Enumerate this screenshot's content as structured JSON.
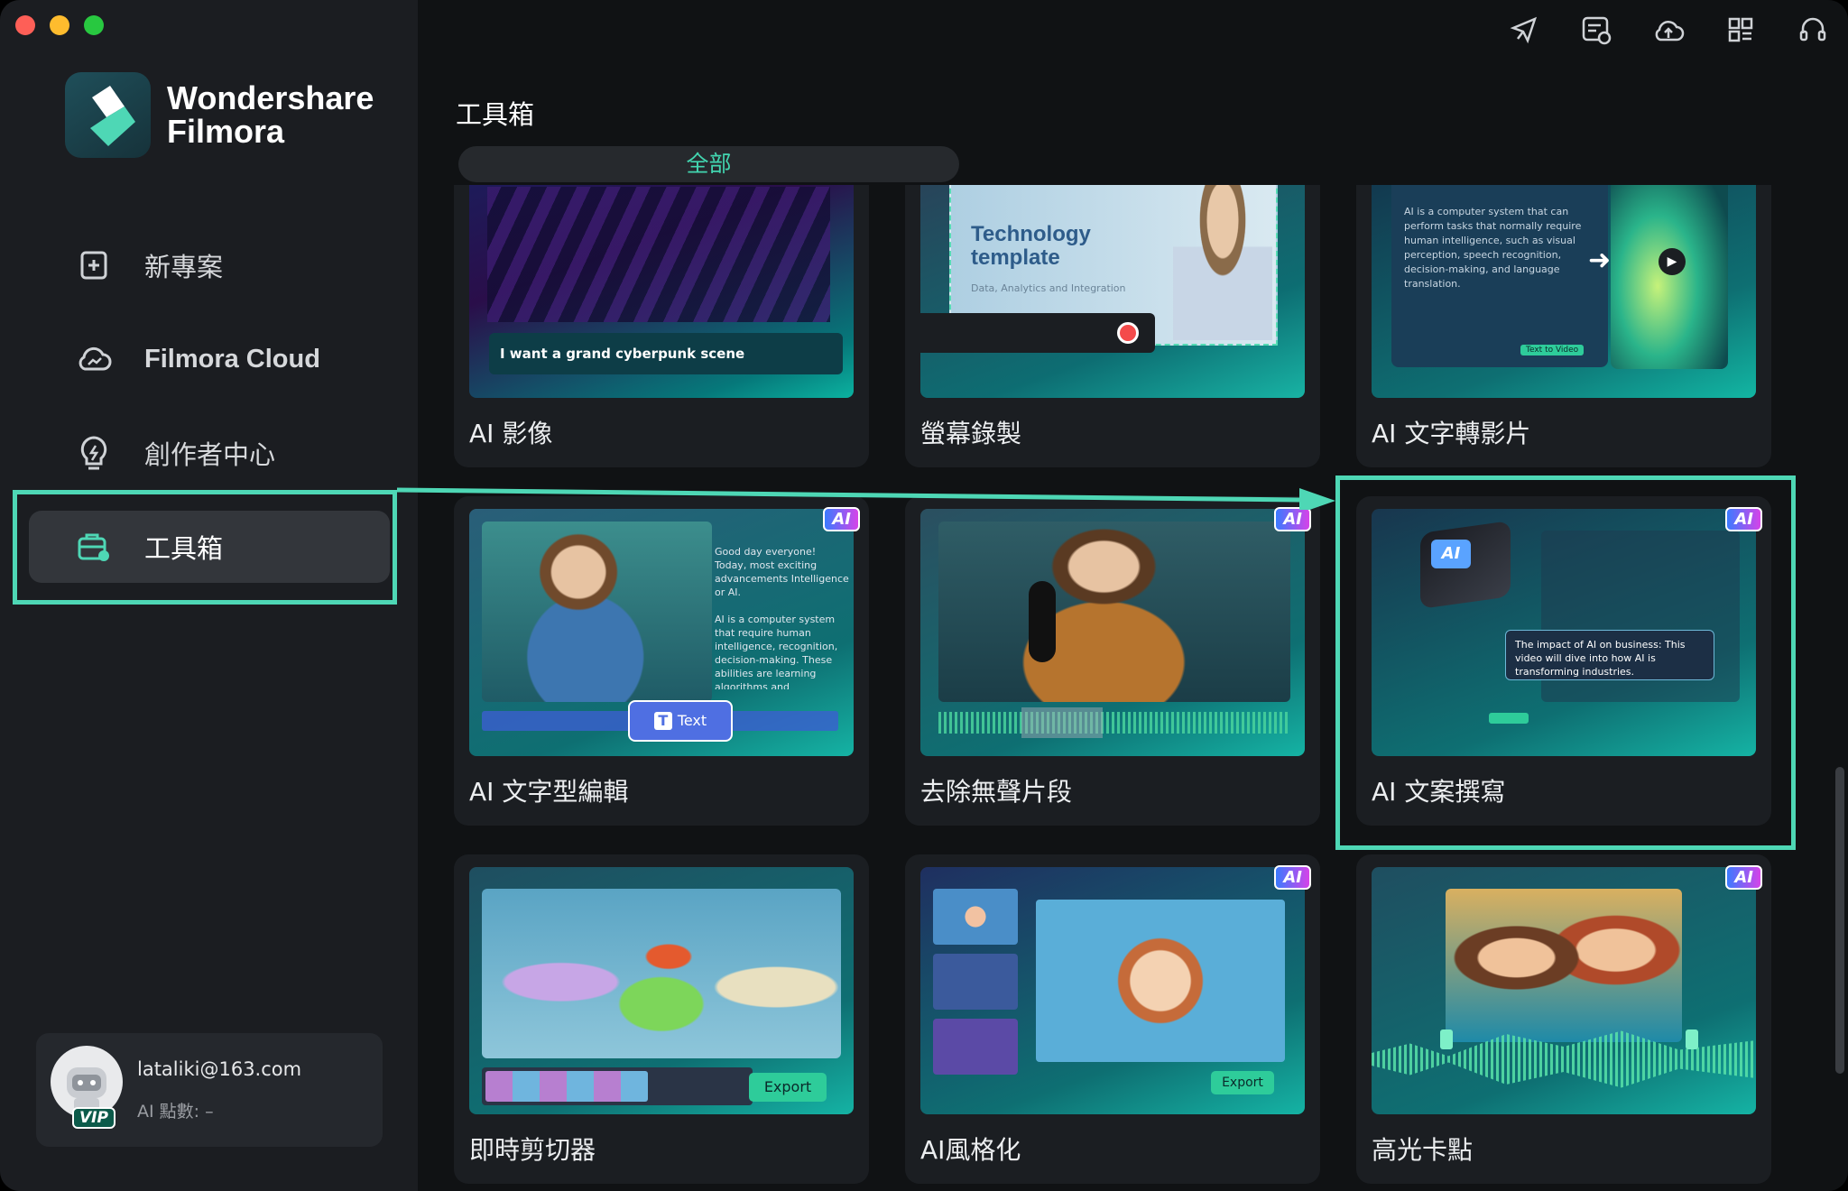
{
  "app": {
    "brand_line1": "Wondershare",
    "brand_line2": "Filmora"
  },
  "sidebar": {
    "items": [
      {
        "label": "新專案",
        "icon": "plus-square-icon"
      },
      {
        "label": "Filmora Cloud",
        "icon": "cloud-icon"
      },
      {
        "label": "創作者中心",
        "icon": "lightbulb-icon"
      },
      {
        "label": "工具箱",
        "icon": "toolbox-icon",
        "active": true
      }
    ]
  },
  "user": {
    "email": "lataliki@163.com",
    "points_label": "AI 點數: –",
    "badge": "VIP"
  },
  "toolbar_icons": [
    "send-feedback-icon",
    "messages-icon",
    "cloud-upload-icon",
    "grid-apps-icon",
    "headset-icon"
  ],
  "main": {
    "title": "工具箱",
    "tab": "全部",
    "cards": [
      {
        "label": "AI 影像",
        "ai": false,
        "thumb_text": "I want a grand cyberpunk scene"
      },
      {
        "label": "螢幕錄製",
        "ai": false,
        "thumb_text": "Technology template",
        "thumb_sub": "Data, Analytics and Integration"
      },
      {
        "label": "AI 文字轉影片",
        "ai": false,
        "thumb_text": "Text to Video"
      },
      {
        "label": "AI 文字型編輯",
        "ai": true,
        "thumb_text": "Text"
      },
      {
        "label": "去除無聲片段",
        "ai": true
      },
      {
        "label": "AI 文案撰寫",
        "ai": true,
        "thumb_text": "The impact of AI on business: This video will dive into how AI is transforming industries."
      },
      {
        "label": "即時剪切器",
        "ai": false,
        "thumb_text": "Export"
      },
      {
        "label": "AI風格化",
        "ai": true,
        "thumb_text": "Export"
      },
      {
        "label": "高光卡點",
        "ai": true
      }
    ],
    "ai_badge": "AI"
  },
  "colors": {
    "accent": "#4ed7b5",
    "sidebar_bg": "#1b1d21",
    "main_bg": "#101214"
  }
}
